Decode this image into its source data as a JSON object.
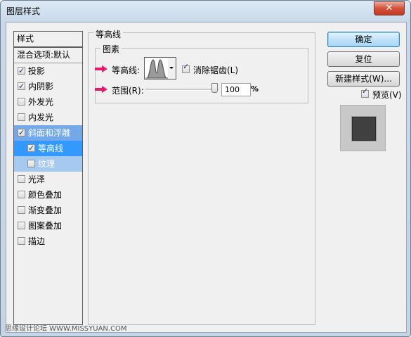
{
  "window": {
    "title": "图层样式",
    "close_label": "✕"
  },
  "style_list": {
    "header": "样式",
    "blend_options": "混合选项:默认",
    "items": [
      {
        "label": "投影",
        "checked": true
      },
      {
        "label": "内阴影",
        "checked": true
      },
      {
        "label": "外发光",
        "checked": false
      },
      {
        "label": "内发光",
        "checked": false
      },
      {
        "label": "斜面和浮雕",
        "checked": true
      },
      {
        "label": "等高线",
        "checked": true
      },
      {
        "label": "纹理",
        "checked": false
      },
      {
        "label": "光泽",
        "checked": false
      },
      {
        "label": "颜色叠加",
        "checked": false
      },
      {
        "label": "渐变叠加",
        "checked": false
      },
      {
        "label": "图案叠加",
        "checked": false
      },
      {
        "label": "描边",
        "checked": false
      }
    ]
  },
  "panel": {
    "group_title": "等高线",
    "subgroup_title": "图素",
    "contour_label": "等高线:",
    "antialias_label": "消除锯齿(L)",
    "antialias_checked": true,
    "range_label": "范围(R):",
    "range_value": "100",
    "range_unit": "%",
    "range_level_percent": 100
  },
  "buttons": {
    "ok": "确定",
    "reset": "复位",
    "new_style": "新建样式(W)...",
    "preview_label": "预览(V)",
    "preview_checked": true
  },
  "watermark": "思缘设计论坛  WWW.MISSYUAN.COM",
  "colors": {
    "arrow": "#e8196a",
    "selection": "#3399ff",
    "selection_light": "#73a9e8"
  }
}
